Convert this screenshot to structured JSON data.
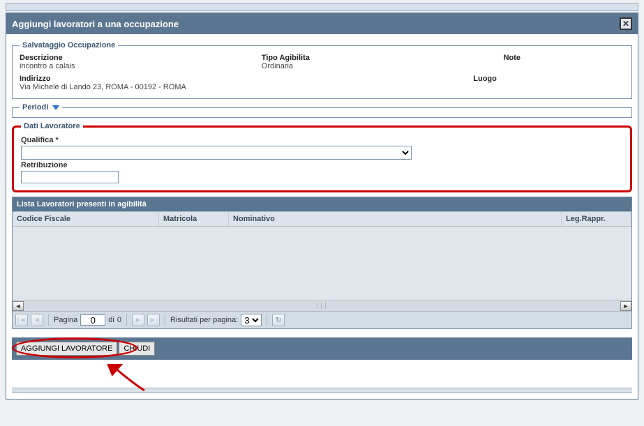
{
  "modal": {
    "title": "Aggiungi lavoratori a una occupazione"
  },
  "salvataggio": {
    "legend": "Salvataggio Occupazione",
    "labels": {
      "descrizione": "Descrizione",
      "tipo_agibilita": "Tipo Agibilita",
      "note": "Note",
      "indirizzo": "Indirizzo",
      "luogo": "Luogo"
    },
    "values": {
      "descrizione": "incontro a calais",
      "tipo_agibilita": "Ordinaria",
      "note": "",
      "indirizzo": "Via Michele di Lando 23, ROMA - 00192 - ROMA",
      "luogo": ""
    }
  },
  "periodi": {
    "legend": "Periodi"
  },
  "dati_lavoratore": {
    "legend": "Dati Lavoratore",
    "qualifica_label": "Qualifica *",
    "qualifica_value": "",
    "retribuzione_label": "Retribuzione",
    "retribuzione_value": ""
  },
  "grid": {
    "title": "Lista Lavoratori presenti in agibilità",
    "columns": {
      "codice_fiscale": "Codice Fiscale",
      "matricola": "Matricola",
      "nominativo": "Nominativo",
      "leg_rappr": "Leg.Rappr."
    }
  },
  "pager": {
    "page_label": "Pagina",
    "page_value": "0",
    "of_label": "di",
    "total_pages": "0",
    "results_label": "Risultati per pagina:",
    "per_page": "3"
  },
  "footer": {
    "aggiungi": "AGGIUNGI LAVORATORE",
    "chiudi": "CHIUDI"
  }
}
